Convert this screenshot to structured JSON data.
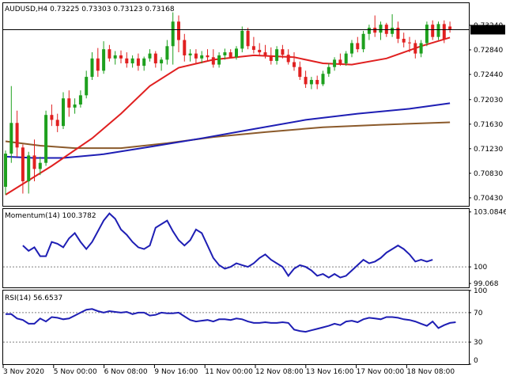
{
  "chart_data": [
    {
      "type": "candlestick",
      "title": "AUDUSD,H4  0.73225 0.73303 0.73123 0.73168",
      "ylim": [
        0.703,
        0.736
      ],
      "y_ticks": [
        "0.73240",
        "0.72840",
        "0.72440",
        "0.72030",
        "0.71630",
        "0.71230",
        "0.70830",
        "0.70430"
      ],
      "current_price": "0.73168",
      "colors": {
        "bull": "#1ea01e",
        "bear": "#e02020",
        "sma_fast": "#e02020",
        "sma_mid": "#1e1eb4",
        "sma_slow": "#8b5a2b",
        "price_line": "#000000"
      },
      "candles": [
        [
          0.7061,
          0.712,
          0.7048,
          0.7115
        ],
        [
          0.7115,
          0.7225,
          0.71,
          0.7165
        ],
        [
          0.7165,
          0.7185,
          0.711,
          0.7125
        ],
        [
          0.7125,
          0.713,
          0.705,
          0.707
        ],
        [
          0.707,
          0.7118,
          0.705,
          0.7112
        ],
        [
          0.7112,
          0.7138,
          0.707,
          0.709
        ],
        [
          0.709,
          0.711,
          0.708,
          0.71
        ],
        [
          0.71,
          0.7185,
          0.7095,
          0.7178
        ],
        [
          0.7178,
          0.7195,
          0.716,
          0.717
        ],
        [
          0.717,
          0.718,
          0.715,
          0.716
        ],
        [
          0.716,
          0.7215,
          0.7155,
          0.7205
        ],
        [
          0.7205,
          0.7218,
          0.7175,
          0.719
        ],
        [
          0.719,
          0.7205,
          0.718,
          0.7195
        ],
        [
          0.7195,
          0.7218,
          0.719,
          0.721
        ],
        [
          0.721,
          0.725,
          0.7205,
          0.724
        ],
        [
          0.724,
          0.728,
          0.7235,
          0.727
        ],
        [
          0.727,
          0.7287,
          0.724,
          0.725
        ],
        [
          0.725,
          0.7298,
          0.7245,
          0.7285
        ],
        [
          0.7285,
          0.7292,
          0.7265,
          0.727
        ],
        [
          0.727,
          0.7282,
          0.726,
          0.7275
        ],
        [
          0.7275,
          0.7283,
          0.7262,
          0.727
        ],
        [
          0.727,
          0.728,
          0.7255,
          0.7262
        ],
        [
          0.7262,
          0.7275,
          0.7255,
          0.727
        ],
        [
          0.727,
          0.7278,
          0.725,
          0.7258
        ],
        [
          0.7258,
          0.7273,
          0.725,
          0.727
        ],
        [
          0.727,
          0.7285,
          0.7265,
          0.7278
        ],
        [
          0.7278,
          0.7282,
          0.7255,
          0.7262
        ],
        [
          0.7262,
          0.7272,
          0.725,
          0.7268
        ],
        [
          0.7268,
          0.73,
          0.726,
          0.729
        ],
        [
          0.729,
          0.7345,
          0.726,
          0.733
        ],
        [
          0.733,
          0.734,
          0.728,
          0.73
        ],
        [
          0.73,
          0.731,
          0.7265,
          0.7275
        ],
        [
          0.7275,
          0.7285,
          0.7265,
          0.7278
        ],
        [
          0.7278,
          0.7285,
          0.7262,
          0.727
        ],
        [
          0.727,
          0.7282,
          0.7262,
          0.7275
        ],
        [
          0.7275,
          0.7285,
          0.7265,
          0.7272
        ],
        [
          0.7272,
          0.7285,
          0.7255,
          0.726
        ],
        [
          0.726,
          0.728,
          0.7255,
          0.7275
        ],
        [
          0.7275,
          0.7286,
          0.7268,
          0.728
        ],
        [
          0.728,
          0.7285,
          0.727,
          0.7272
        ],
        [
          0.7272,
          0.729,
          0.7268,
          0.7286
        ],
        [
          0.7286,
          0.7322,
          0.728,
          0.7315
        ],
        [
          0.7315,
          0.732,
          0.7285,
          0.729
        ],
        [
          0.729,
          0.7305,
          0.7278,
          0.7284
        ],
        [
          0.7284,
          0.7295,
          0.7275,
          0.728
        ],
        [
          0.728,
          0.7292,
          0.727,
          0.7275
        ],
        [
          0.7275,
          0.7288,
          0.726,
          0.7266
        ],
        [
          0.7266,
          0.729,
          0.726,
          0.7285
        ],
        [
          0.7285,
          0.7292,
          0.727,
          0.7276
        ],
        [
          0.7276,
          0.7285,
          0.726,
          0.7264
        ],
        [
          0.7264,
          0.728,
          0.725,
          0.7256
        ],
        [
          0.7256,
          0.7265,
          0.7235,
          0.724
        ],
        [
          0.724,
          0.725,
          0.7222,
          0.7228
        ],
        [
          0.7228,
          0.724,
          0.722,
          0.7235
        ],
        [
          0.7235,
          0.7242,
          0.722,
          0.7228
        ],
        [
          0.7228,
          0.725,
          0.7225,
          0.7245
        ],
        [
          0.7245,
          0.7262,
          0.724,
          0.7256
        ],
        [
          0.7256,
          0.7272,
          0.725,
          0.7268
        ],
        [
          0.7268,
          0.7278,
          0.7258,
          0.7262
        ],
        [
          0.7262,
          0.7282,
          0.7258,
          0.7278
        ],
        [
          0.7278,
          0.73,
          0.7272,
          0.7295
        ],
        [
          0.7295,
          0.7305,
          0.728,
          0.7285
        ],
        [
          0.7285,
          0.7315,
          0.728,
          0.731
        ],
        [
          0.731,
          0.7325,
          0.73,
          0.732
        ],
        [
          0.732,
          0.734,
          0.7305,
          0.7312
        ],
        [
          0.7312,
          0.733,
          0.73,
          0.7325
        ],
        [
          0.7325,
          0.7328,
          0.7305,
          0.731
        ],
        [
          0.731,
          0.7342,
          0.7305,
          0.732
        ],
        [
          0.732,
          0.733,
          0.7295,
          0.7302
        ],
        [
          0.7302,
          0.7312,
          0.7288,
          0.7296
        ],
        [
          0.7296,
          0.7305,
          0.728,
          0.7295
        ],
        [
          0.7295,
          0.73,
          0.727,
          0.7278
        ],
        [
          0.7278,
          0.73,
          0.7272,
          0.7295
        ],
        [
          0.7295,
          0.733,
          0.729,
          0.7325
        ],
        [
          0.7325,
          0.7332,
          0.73,
          0.7305
        ],
        [
          0.7305,
          0.733,
          0.73,
          0.7326
        ],
        [
          0.7326,
          0.7332,
          0.7295,
          0.7302
        ],
        [
          0.7322,
          0.733,
          0.7312,
          0.7317
        ]
      ],
      "sma_fast": [
        [
          0,
          0.7048
        ],
        [
          8,
          0.7095
        ],
        [
          15,
          0.714
        ],
        [
          20,
          0.718
        ],
        [
          25,
          0.7225
        ],
        [
          30,
          0.7255
        ],
        [
          36,
          0.7268
        ],
        [
          43,
          0.7275
        ],
        [
          50,
          0.7272
        ],
        [
          55,
          0.7262
        ],
        [
          60,
          0.726
        ],
        [
          66,
          0.727
        ],
        [
          72,
          0.729
        ],
        [
          77,
          0.7304
        ]
      ],
      "sma_mid": [
        [
          0,
          0.711
        ],
        [
          5,
          0.7108
        ],
        [
          10,
          0.7108
        ],
        [
          17,
          0.7114
        ],
        [
          25,
          0.7126
        ],
        [
          34,
          0.714
        ],
        [
          43,
          0.7155
        ],
        [
          52,
          0.717
        ],
        [
          61,
          0.718
        ],
        [
          70,
          0.7188
        ],
        [
          77,
          0.7197
        ]
      ],
      "sma_slow": [
        [
          0,
          0.7135
        ],
        [
          6,
          0.7128
        ],
        [
          12,
          0.7124
        ],
        [
          20,
          0.7124
        ],
        [
          28,
          0.7132
        ],
        [
          36,
          0.7142
        ],
        [
          45,
          0.715
        ],
        [
          55,
          0.7158
        ],
        [
          65,
          0.7162
        ],
        [
          77,
          0.7166
        ]
      ]
    },
    {
      "type": "line",
      "title": "Momentum(14) 100.3782",
      "ylim": [
        98.85,
        103.25
      ],
      "y_ticks": [
        "103.0846",
        "100",
        "99.068"
      ],
      "y_tick_values": [
        103.0846,
        100,
        99.068
      ],
      "reference_level": 100,
      "color": "#1e1eb4",
      "values": [
        101.2,
        100.9,
        101.1,
        100.6,
        100.6,
        101.4,
        101.3,
        101.1,
        101.6,
        101.9,
        101.4,
        101.0,
        101.4,
        102.0,
        102.6,
        103.0,
        102.7,
        102.1,
        101.8,
        101.4,
        101.1,
        101.0,
        101.2,
        102.2,
        102.4,
        102.6,
        102.0,
        101.5,
        101.2,
        101.5,
        102.1,
        101.9,
        101.2,
        100.5,
        100.1,
        99.9,
        100.0,
        100.2,
        100.1,
        100.0,
        100.2,
        100.5,
        100.7,
        100.4,
        100.2,
        100.0,
        99.5,
        99.9,
        100.1,
        100.0,
        99.8,
        99.5,
        99.6,
        99.4,
        99.6,
        99.4,
        99.5,
        99.8,
        100.1,
        100.4,
        100.2,
        100.3,
        100.5,
        100.8,
        101.0,
        101.2,
        101.0,
        100.7,
        100.3,
        100.4,
        100.3,
        100.4
      ],
      "x_start": 3
    },
    {
      "type": "line",
      "title": "RSI(14) 56.6537",
      "ylim": [
        0,
        100
      ],
      "y_ticks": [
        "100",
        "70",
        "30",
        "0"
      ],
      "y_tick_values": [
        100,
        70,
        30,
        0
      ],
      "levels": [
        70,
        30
      ],
      "color": "#1e1eb4",
      "values": [
        68,
        68,
        62,
        60,
        55,
        55,
        62,
        58,
        64,
        63,
        61,
        62,
        66,
        70,
        74,
        75,
        72,
        70,
        72,
        71,
        70,
        71,
        68,
        70,
        70,
        66,
        67,
        70,
        69,
        69,
        70,
        65,
        60,
        58,
        59,
        60,
        58,
        61,
        61,
        60,
        62,
        61,
        58,
        56,
        56,
        57,
        56,
        56,
        57,
        56,
        47,
        45,
        44,
        46,
        48,
        50,
        52,
        55,
        53,
        58,
        59,
        57,
        61,
        63,
        62,
        61,
        64,
        64,
        63,
        61,
        60,
        58,
        55,
        52,
        58,
        49,
        53,
        56,
        57
      ],
      "x_start": 0
    }
  ],
  "x_axis": {
    "labels": [
      "3 Nov 2020",
      "5 Nov 00:00",
      "6 Nov 08:00",
      "9 Nov 16:00",
      "11 Nov 00:00",
      "12 Nov 08:00",
      "13 Nov 16:00",
      "17 Nov 00:00",
      "18 Nov 08:00"
    ],
    "label_index": [
      0,
      12,
      24,
      36,
      48,
      60,
      72,
      84,
      96
    ]
  }
}
